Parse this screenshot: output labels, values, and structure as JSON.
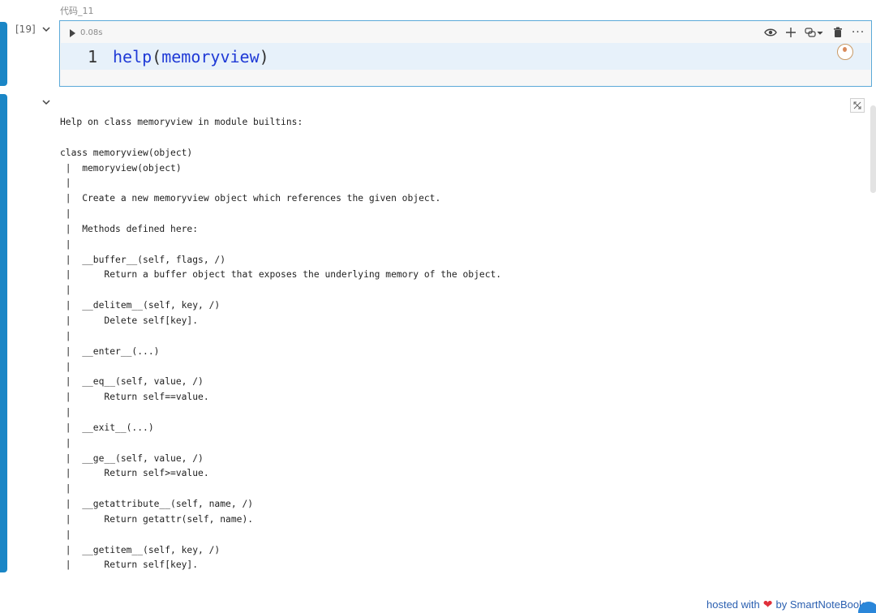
{
  "cell": {
    "title": "代码_11",
    "execution_count": "[19]",
    "run_time": "0.08s",
    "line_number": "1",
    "code": {
      "func": "help",
      "open": "(",
      "arg": "memoryview",
      "close": ")"
    },
    "toolbar": {
      "icons": [
        "eye-icon",
        "add-icon",
        "python-env-icon",
        "delete-icon",
        "more-icon"
      ],
      "more": "···"
    }
  },
  "output": {
    "text": "Help on class memoryview in module builtins:\n\nclass memoryview(object)\n |  memoryview(object)\n |  \n |  Create a new memoryview object which references the given object.\n |  \n |  Methods defined here:\n |  \n |  __buffer__(self, flags, /)\n |      Return a buffer object that exposes the underlying memory of the object.\n |  \n |  __delitem__(self, key, /)\n |      Delete self[key].\n |  \n |  __enter__(...)\n |  \n |  __eq__(self, value, /)\n |      Return self==value.\n |  \n |  __exit__(...)\n |  \n |  __ge__(self, value, /)\n |      Return self>=value.\n |  \n |  __getattribute__(self, name, /)\n |      Return getattr(self, name).\n |  \n |  __getitem__(self, key, /)\n |      Return self[key]."
  },
  "footer": {
    "hosted_with": "hosted with",
    "by": "by SmartNoteBook"
  },
  "colors": {
    "accent": "#1a86c6",
    "code_keyword": "#1f3ad6",
    "footer_link": "#2a5fb0",
    "heart": "#e0303a"
  }
}
